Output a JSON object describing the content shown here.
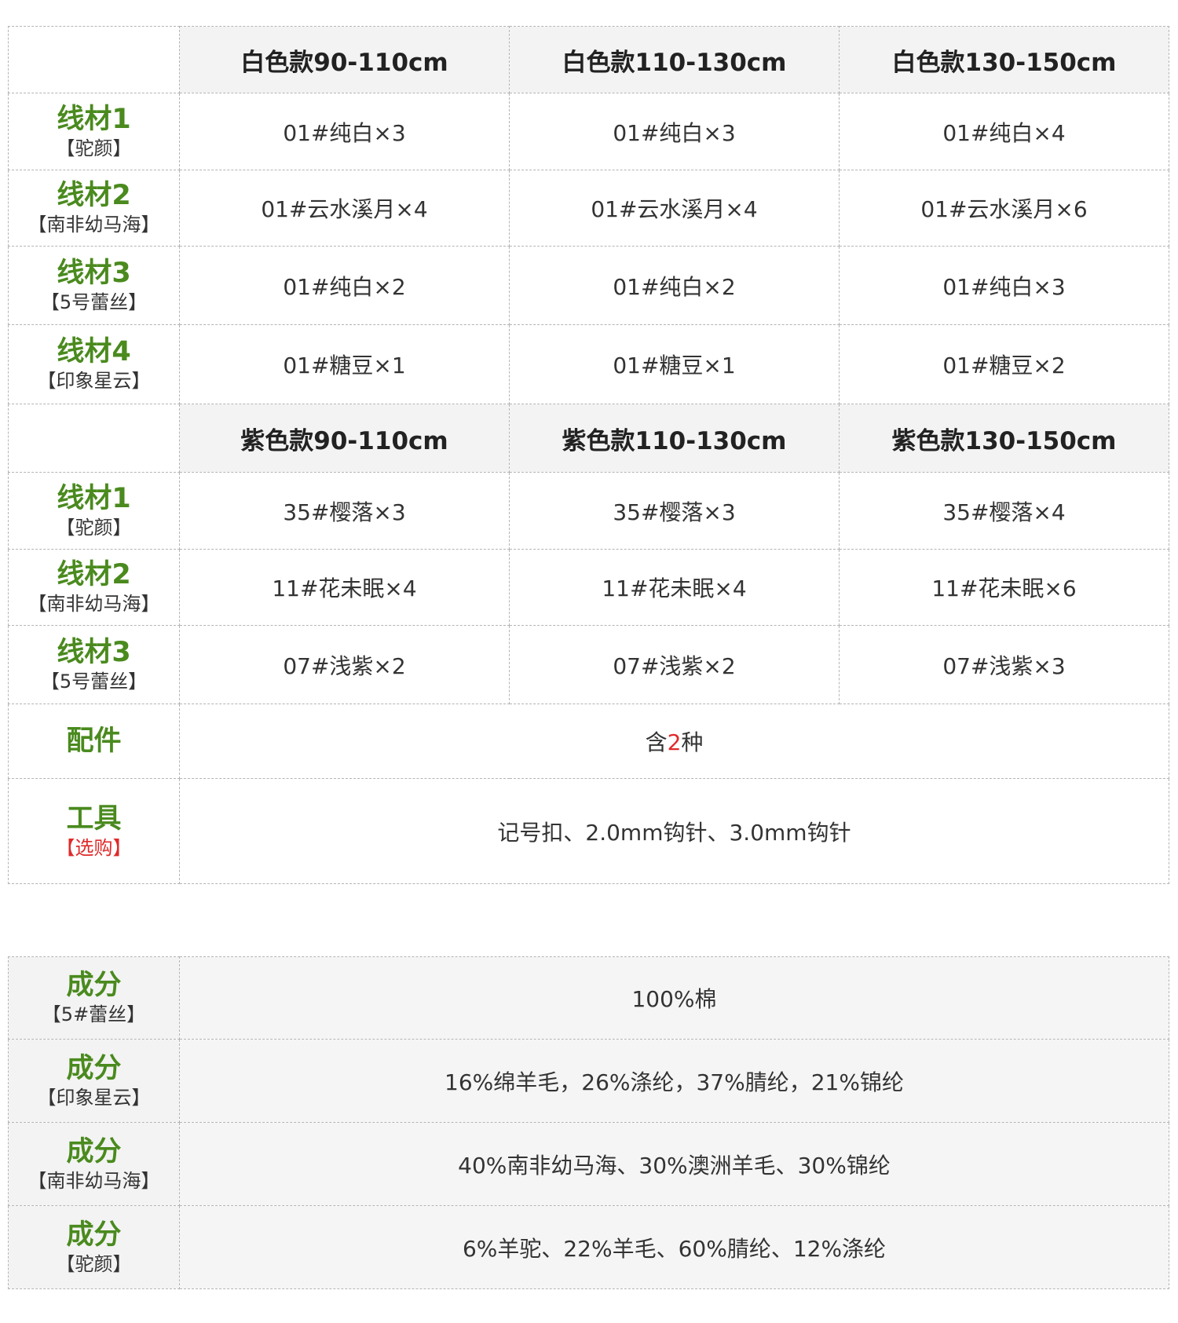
{
  "white_section": {
    "headers": [
      "白色款90-110cm",
      "白色款110-130cm",
      "白色款130-150cm"
    ],
    "rows": [
      {
        "label": "线材1",
        "sub": "【驼颜】",
        "values": [
          "01#纯白×3",
          "01#纯白×3",
          "01#纯白×4"
        ]
      },
      {
        "label": "线材2",
        "sub": "【南非幼马海】",
        "values": [
          "01#云水溪月×4",
          "01#云水溪月×4",
          "01#云水溪月×6"
        ]
      },
      {
        "label": "线材3",
        "sub": "【5号蕾丝】",
        "values": [
          "01#纯白×2",
          "01#纯白×2",
          "01#纯白×3"
        ]
      },
      {
        "label": "线材4",
        "sub": "【印象星云】",
        "values": [
          "01#糖豆×1",
          "01#糖豆×1",
          "01#糖豆×2"
        ]
      }
    ]
  },
  "purple_section": {
    "headers": [
      "紫色款90-110cm",
      "紫色款110-130cm",
      "紫色款130-150cm"
    ],
    "rows": [
      {
        "label": "线材1",
        "sub": "【驼颜】",
        "values": [
          "35#樱落×3",
          "35#樱落×3",
          "35#樱落×4"
        ]
      },
      {
        "label": "线材2",
        "sub": "【南非幼马海】",
        "values": [
          "11#花未眠×4",
          "11#花未眠×4",
          "11#花未眠×6"
        ]
      },
      {
        "label": "线材3",
        "sub": "【5号蕾丝】",
        "values": [
          "07#浅紫×2",
          "07#浅紫×2",
          "07#浅紫×3"
        ]
      }
    ]
  },
  "accessories": {
    "label": "配件",
    "value_prefix": "含",
    "value_count": "2",
    "value_suffix": "种"
  },
  "tools": {
    "label": "工具",
    "sub": "【选购】",
    "value": "记号扣、2.0mm钩针、3.0mm钩针"
  },
  "composition": [
    {
      "label": "成分",
      "sub": "【5#蕾丝】",
      "value": "100%棉"
    },
    {
      "label": "成分",
      "sub": "【印象星云】",
      "value": "16%绵羊毛，26%涤纶，37%腈纶，21%锦纶"
    },
    {
      "label": "成分",
      "sub": "【南非幼马海】",
      "value": "40%南非幼马海、30%澳洲羊毛、30%锦纶"
    },
    {
      "label": "成分",
      "sub": "【驼颜】",
      "value": "6%羊驼、22%羊毛、60%腈纶、12%涤纶"
    }
  ],
  "colors": {
    "label_green": "#4a8a1e",
    "highlight_red": "#e02a2a",
    "header_bg": "#f3f3f3",
    "border": "#b4b4b4"
  }
}
